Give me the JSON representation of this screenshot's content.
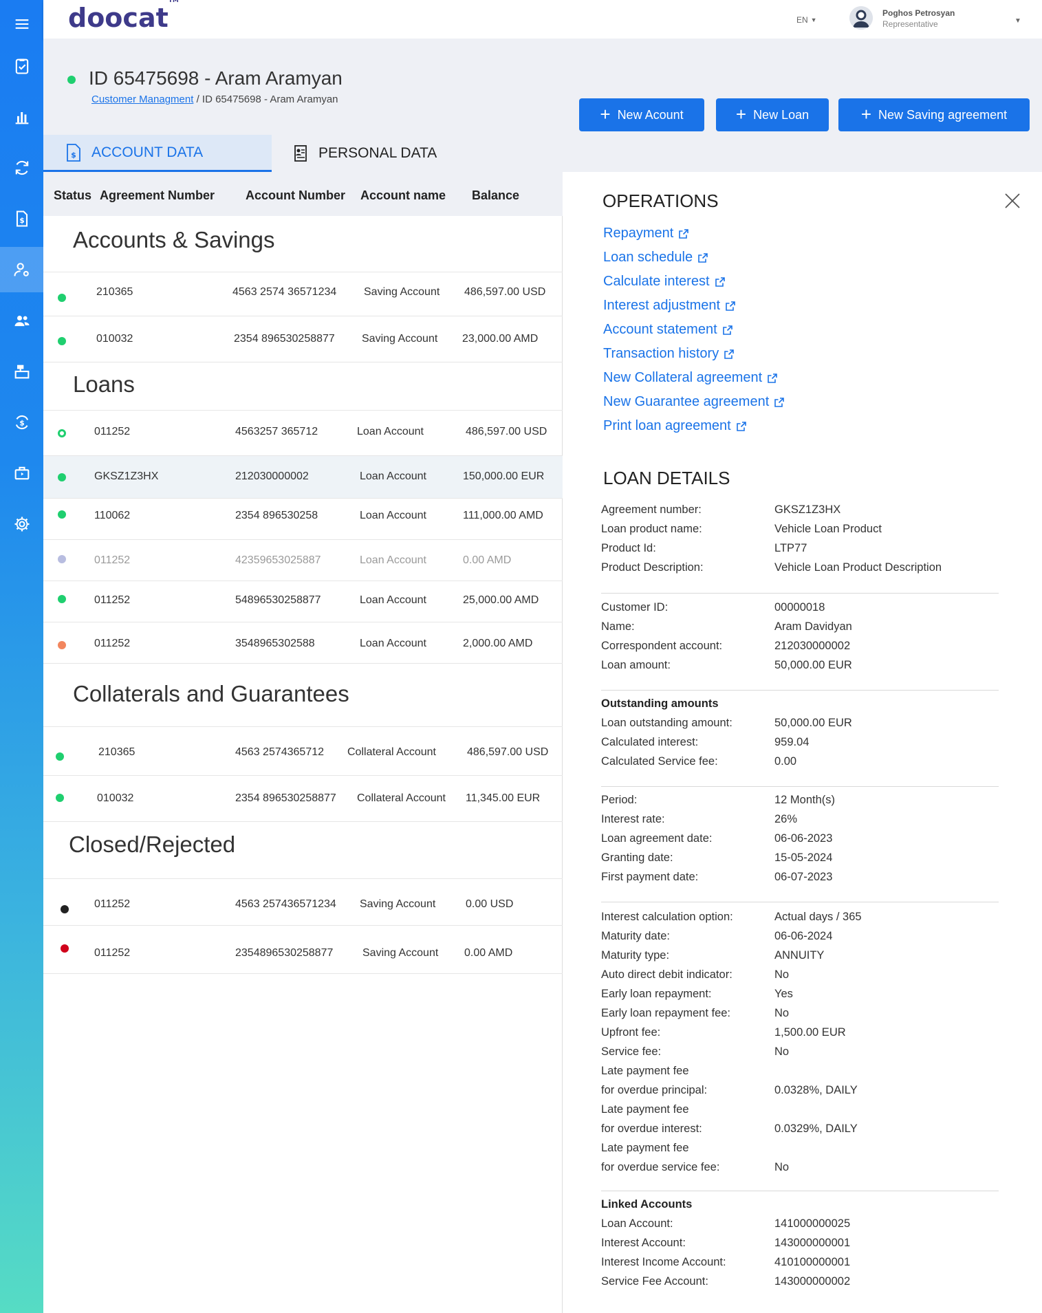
{
  "app": {
    "logo": "doocat",
    "tm": "TM"
  },
  "topbar": {
    "lang": "EN",
    "user_name": "Poghos Petrosyan",
    "user_role": "Representative"
  },
  "header": {
    "title": "ID  65475698 - Aram Aramyan",
    "breadcrumb_link": "Customer Managment",
    "breadcrumb_sep": " / ",
    "breadcrumb_current": "ID  65475698 - Aram Aramyan",
    "buttons": [
      "New Acount",
      "New Loan",
      "New Saving agreement"
    ]
  },
  "tabs": {
    "account": "ACCOUNT DATA",
    "personal": "PERSONAL DATA"
  },
  "table": {
    "headers": [
      "Status",
      "Agreement Number",
      "Account Number",
      "Account name",
      "Balance"
    ],
    "sections": {
      "accounts": "Accounts & Savings",
      "loans": "Loans",
      "collaterals": "Collaterals and Guarantees",
      "closed": "Closed/Rejected"
    },
    "accounts_rows": [
      {
        "agreement": "210365",
        "account": "4563 2574 36571234",
        "name": "Saving Account",
        "balance": "486,597.00 USD",
        "status_color": "#1fcf6f"
      },
      {
        "agreement": "010032",
        "account": "2354 896530258877",
        "name": "Saving Account",
        "balance": "23,000.00  AMD",
        "status_color": "#1fcf6f"
      }
    ],
    "loan_rows": [
      {
        "agreement": "011252",
        "account": "4563257 365712",
        "name": "Loan Account",
        "balance": "486,597.00 USD",
        "status_color": "ring"
      },
      {
        "agreement": "GKSZ1Z3HX",
        "account": "212030000002",
        "name": "Loan Account",
        "balance": "150,000.00 EUR",
        "status_color": "#1fcf6f"
      },
      {
        "agreement": "110062",
        "account": "2354 896530258",
        "name": "Loan Account",
        "balance": "111,000.00 AMD",
        "status_color": "#1fcf6f"
      },
      {
        "agreement": "011252",
        "account": "42359653025887",
        "name": "Loan Account",
        "balance": "0.00 AMD",
        "status_color": "#b8bde0"
      },
      {
        "agreement": "011252",
        "account": "54896530258877",
        "name": "Loan Account",
        "balance": "25,000.00 AMD",
        "status_color": "#1fcf6f"
      },
      {
        "agreement": "011252",
        "account": "3548965302588",
        "name": "Loan Account",
        "balance": "2,000.00  AMD",
        "status_color": "#f2865e"
      }
    ],
    "collateral_rows": [
      {
        "agreement": "210365",
        "account": "4563 2574365712",
        "name": "Collateral  Account",
        "balance": "486,597.00 USD",
        "status_color": "#1fcf6f"
      },
      {
        "agreement": "010032",
        "account": "2354 896530258877",
        "name": "Collateral  Account",
        "balance": "11,345.00 EUR",
        "status_color": "#1fcf6f"
      }
    ],
    "closed_rows": [
      {
        "agreement": "011252",
        "account": "4563 257436571234",
        "name": "Saving Account",
        "balance": "0.00  USD",
        "status_color": "#222222"
      },
      {
        "agreement": "011252",
        "account": "2354896530258877",
        "name": "Saving Account",
        "balance": "0.00  AMD",
        "status_color": "#d0021b"
      }
    ]
  },
  "operations": {
    "title": "OPERATIONS",
    "links": [
      "Repayment",
      "Loan schedule",
      "Calculate interest",
      "Interest adjustment",
      "Account statement",
      "Transaction history",
      "New Collateral agreement",
      "New Guarantee agreement",
      "Print loan agreement"
    ]
  },
  "loan_details": {
    "title": "LOAN DETAILS",
    "group1": [
      {
        "label": "Agreement number:",
        "value": "GKSZ1Z3HX"
      },
      {
        "label": "Loan product name:",
        "value": "Vehicle Loan Product"
      },
      {
        "label": "Product Id:",
        "value": "LTP77"
      },
      {
        "label": "Product Description:",
        "value": "Vehicle Loan Product Description"
      }
    ],
    "group2": [
      {
        "label": "Customer ID:",
        "value": "00000018"
      },
      {
        "label": "Name:",
        "value": "Aram Davidyan"
      },
      {
        "label": "Correspondent account:",
        "value": "212030000002"
      },
      {
        "label": "Loan amount:",
        "value": "50,000.00 EUR"
      }
    ],
    "outstanding_title": "Outstanding amounts",
    "group3": [
      {
        "label": "Loan outstanding amount:",
        "value": "50,000.00 EUR"
      },
      {
        "label": "Calculated interest:",
        "value": "959.04"
      },
      {
        "label": "Calculated Service fee:",
        "value": "0.00"
      }
    ],
    "group4": [
      {
        "label": "Period:",
        "value": "12 Month(s)"
      },
      {
        "label": "Interest rate:",
        "value": "26%"
      },
      {
        "label": "Loan agreement date:",
        "value": "06-06-2023"
      },
      {
        "label": "Granting date:",
        "value": "15-05-2024"
      },
      {
        "label": "First payment date:",
        "value": "06-07-2023"
      }
    ],
    "group5": [
      {
        "label": "Interest calculation option:",
        "value": "Actual days / 365"
      },
      {
        "label": "Maturity date:",
        "value": "06-06-2024"
      },
      {
        "label": "Maturity type:",
        "value": "ANNUITY"
      },
      {
        "label": "Auto direct debit indicator:",
        "value": "No"
      },
      {
        "label": "Early loan repayment:",
        "value": "Yes"
      },
      {
        "label": "Early loan repayment fee:",
        "value": "No"
      },
      {
        "label": "Upfront fee:",
        "value": "1,500.00 EUR"
      },
      {
        "label": "Service fee:",
        "value": "No"
      }
    ],
    "late_fees": [
      {
        "label1": "Late payment fee",
        "label2": "for overdue principal:",
        "value": "0.0328%, DAILY"
      },
      {
        "label1": "Late payment fee",
        "label2": "for overdue interest:",
        "value": "0.0329%, DAILY"
      },
      {
        "label1": "Late payment fee",
        "label2": " for overdue service fee:",
        "value": "No"
      }
    ],
    "linked_title": "Linked Accounts",
    "linked": [
      {
        "label": "Loan Account:",
        "value": "141000000025"
      },
      {
        "label": "Interest Account:",
        "value": "143000000001"
      },
      {
        "label": "Interest Income Account:",
        "value": "410100000001"
      },
      {
        "label": "Service Fee Account:",
        "value": "143000000002"
      }
    ]
  },
  "sidebar": {
    "items": [
      "menu-icon",
      "clipboard-check-icon",
      "bar-chart-icon",
      "refresh-cycle-icon",
      "dollar-document-icon",
      "user-settings-icon",
      "users-icon",
      "cash-register-icon",
      "dollar-exchange-icon",
      "briefcase-icon",
      "gear-icon"
    ]
  },
  "colors": {
    "accent": "#1a73e8",
    "active_status": "#1fcf6f"
  }
}
